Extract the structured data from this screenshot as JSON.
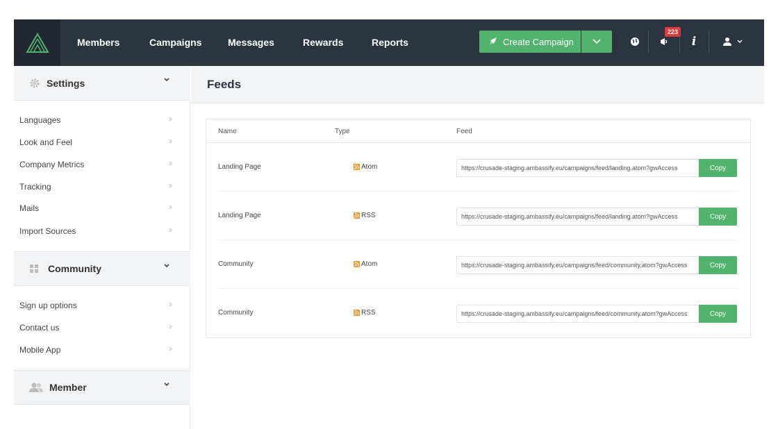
{
  "nav": {
    "items": [
      "Members",
      "Campaigns",
      "Messages",
      "Rewards",
      "Reports"
    ],
    "create_label": "Create Campaign",
    "badge_count": "223",
    "accent": "#52b36f",
    "bg": "#2c3440"
  },
  "sidebar": {
    "settings": {
      "title": "Settings",
      "items": [
        "Languages",
        "Look and Feel",
        "Company Metrics",
        "Tracking",
        "Mails",
        "Import Sources"
      ]
    },
    "community": {
      "title": "Community",
      "items": [
        "Sign up options",
        "Contact us",
        "Mobile App"
      ]
    },
    "member": {
      "title": "Member"
    }
  },
  "page": {
    "title": "Feeds"
  },
  "table": {
    "headers": [
      "Name",
      "Type",
      "Feed"
    ],
    "copy_label": "Copy",
    "rows": [
      {
        "name": "Landing Page",
        "type": "Atom",
        "feed": "https://crusade-staging.ambassify.eu/campaigns/feed/landing.atom?gwAccess"
      },
      {
        "name": "Landing Page",
        "type": "RSS",
        "feed": "https://crusade-staging.ambassify.eu/campaigns/feed/landing.atom?gwAccess"
      },
      {
        "name": "Community",
        "type": "Atom",
        "feed": "https://crusade-staging.ambassify.eu/campaigns/feed/community.atom?gwAccess"
      },
      {
        "name": "Community",
        "type": "RSS",
        "feed": "https://crusade-staging.ambassify.eu/campaigns/feed/community.atom?gwAccess"
      }
    ]
  }
}
